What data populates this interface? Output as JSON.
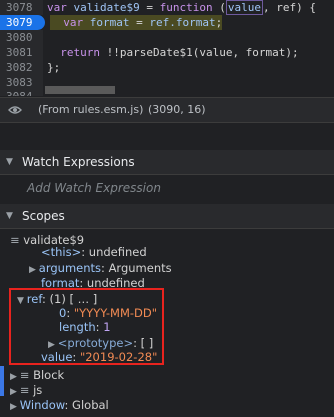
{
  "editor": {
    "lines": [
      {
        "num": "3078",
        "text_a": "var validate$9 = function (",
        "param1": "value",
        "text_b": ", ref) {",
        "active": false
      },
      {
        "num": "3079",
        "text_a": "var format = ref.format;",
        "active": true
      },
      {
        "num": "3080",
        "text_a": "",
        "active": false
      },
      {
        "num": "3081",
        "text_a": "  return !!parseDate$1(value, format);",
        "active": false
      },
      {
        "num": "3082",
        "text_a": "};",
        "active": false
      },
      {
        "num": "3083",
        "text_a": "",
        "active": false
      },
      {
        "num": "3084",
        "text_a": "",
        "active": false
      }
    ]
  },
  "statusbar": {
    "icon": "eye-icon",
    "source": "(From rules.esm.js)",
    "position": "(3090, 16)"
  },
  "watch": {
    "title": "Watch Expressions",
    "placeholder": "Add Watch Expression"
  },
  "scopes": {
    "title": "Scopes",
    "local_name": "validate$9",
    "this_key": "<this>",
    "this_val": "undefined",
    "arguments_key": "arguments",
    "arguments_val": "Arguments",
    "format_key": "format",
    "format_val": "undefined",
    "ref_key": "ref",
    "ref_val": "(1) [ … ]",
    "item0_key": "0",
    "item0_val": "\"YYYY-MM-DD\"",
    "length_key": "length",
    "length_val": "1",
    "proto_key": "<prototype>",
    "proto_val": "[ ]",
    "value_key": "value",
    "value_val": "\"2019-02-28\"",
    "block": "Block",
    "js": "js",
    "window_key": "Window",
    "window_val": "Global"
  }
}
